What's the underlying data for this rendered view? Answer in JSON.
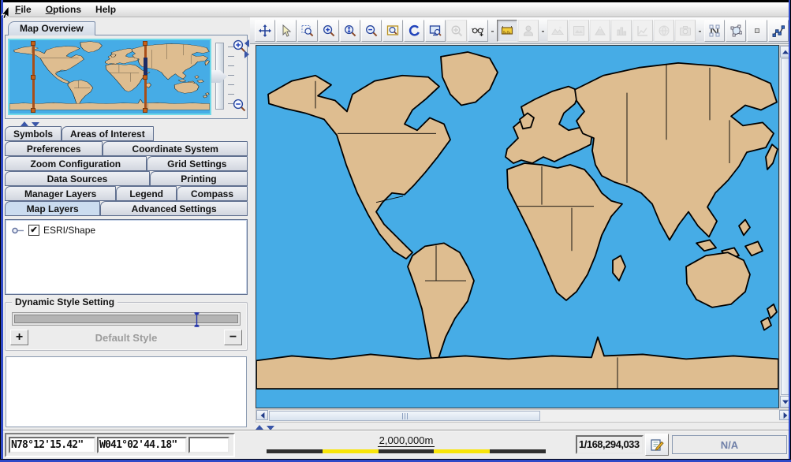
{
  "menu": {
    "items": [
      {
        "label": "File",
        "underline": 0
      },
      {
        "label": "Options",
        "underline": 0
      },
      {
        "label": "Help",
        "underline": -1
      }
    ]
  },
  "overview": {
    "tab_label": "Map Overview"
  },
  "tabs": {
    "rows": [
      [
        {
          "label": "Symbols"
        },
        {
          "label": "Areas of Interest"
        }
      ],
      [
        {
          "label": "Preferences"
        },
        {
          "label": "Coordinate System"
        }
      ],
      [
        {
          "label": "Zoom Configuration"
        },
        {
          "label": "Grid Settings"
        }
      ],
      [
        {
          "label": "Data Sources"
        },
        {
          "label": "Printing"
        }
      ],
      [
        {
          "label": "Manager Layers"
        },
        {
          "label": "Legend"
        },
        {
          "label": "Compass"
        }
      ],
      [
        {
          "label": "Map Layers",
          "selected": true
        },
        {
          "label": "Advanced Settings"
        }
      ]
    ]
  },
  "layers_tree": {
    "items": [
      {
        "label": "ESRI/Shape",
        "checked": true
      }
    ]
  },
  "style_panel": {
    "title": "Dynamic Style Setting",
    "default_label": "Default Style",
    "plus_label": "+",
    "minus_label": "−"
  },
  "toolbar": {
    "items": [
      {
        "name": "pan-tool",
        "icon": "pan"
      },
      {
        "name": "select-tool",
        "icon": "select"
      },
      {
        "name": "zoom-area-tool",
        "icon": "zoom-area"
      },
      {
        "name": "zoom-in-tool",
        "icon": "zoom-in"
      },
      {
        "name": "zoom-scale-tool",
        "icon": "zoom-scale"
      },
      {
        "name": "zoom-out-tool",
        "icon": "zoom-out"
      },
      {
        "name": "zoom-window-tool",
        "icon": "zoom-window"
      },
      {
        "name": "refresh-tool",
        "icon": "refresh"
      },
      {
        "name": "screen-query-tool",
        "icon": "screen-query"
      },
      {
        "name": "center-view-tool",
        "icon": "center-target",
        "disabled": true
      },
      {
        "name": "magnifier-view-tool",
        "icon": "glasses-plus"
      },
      {
        "separator": true,
        "label": "-"
      },
      {
        "name": "measure-tool",
        "icon": "ruler",
        "active": true
      },
      {
        "name": "tracking-tool",
        "icon": "person",
        "disabled": true
      },
      {
        "separator": true,
        "label": "-"
      },
      {
        "name": "elevation-layer-tool",
        "icon": "mountains",
        "disabled": true
      },
      {
        "name": "image-layer-tool",
        "icon": "picture",
        "disabled": true
      },
      {
        "name": "terrain-layer-tool",
        "icon": "mountain",
        "disabled": true
      },
      {
        "name": "histogram-tool",
        "icon": "bars",
        "disabled": true
      },
      {
        "name": "profile-tool",
        "icon": "line-chart",
        "disabled": true
      },
      {
        "name": "globe-tool",
        "icon": "globe",
        "disabled": true
      },
      {
        "name": "snapshot-tool",
        "icon": "camera",
        "disabled": true
      },
      {
        "separator": true,
        "label": "-"
      },
      {
        "name": "node-edit-tool",
        "icon": "n-edit"
      },
      {
        "name": "polygon-tool",
        "icon": "polygon"
      },
      {
        "name": "point-tool",
        "icon": "point"
      },
      {
        "name": "polyline-tool",
        "icon": "polyline"
      }
    ]
  },
  "status": {
    "latitude": "N78°12'15.42\"",
    "longitude": "W041°02'44.18\"",
    "field3": "",
    "scale_label": "2,000,000m",
    "scale_segments": [
      "#303030",
      "#F8E50A",
      "#303030",
      "#F8E50A",
      "#303030"
    ],
    "scale_ratio": "1/168,294,033",
    "progress_label": "N/A"
  },
  "colors": {
    "ocean": "#46ACE6",
    "land": "#DEBD90",
    "coastline": "#000000",
    "selection_orange": "#A84E18",
    "accent_navy": "#26449C"
  }
}
